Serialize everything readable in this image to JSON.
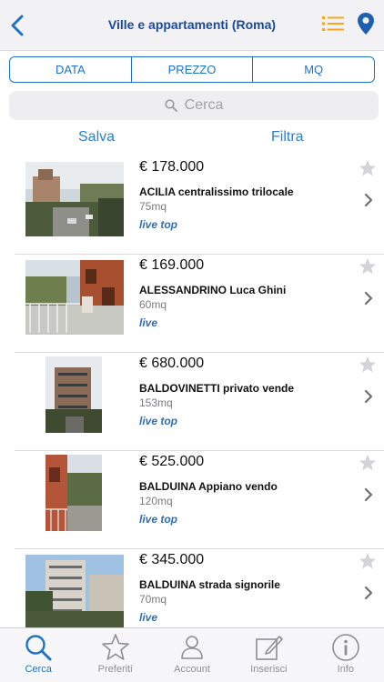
{
  "header": {
    "title": "Ville e appartamenti (Roma)",
    "back_icon": "chevron-left-icon",
    "list_icon": "list-icon",
    "location_icon": "map-pin-icon",
    "accent_color": "#1a4a9a",
    "icon_orange": "#f5a623"
  },
  "sort_tabs": [
    "DATA",
    "PREZZO",
    "MQ"
  ],
  "search": {
    "placeholder": "Cerca"
  },
  "actions": {
    "save_label": "Salva",
    "filter_label": "Filtra"
  },
  "listings": [
    {
      "price": "€ 178.000",
      "title": "ACILIA centralissimo trilocale",
      "size": "75mq",
      "badge": "live top"
    },
    {
      "price": "€ 169.000",
      "title": "ALESSANDRINO Luca Ghini",
      "size": "60mq",
      "badge": "live"
    },
    {
      "price": "€ 680.000",
      "title": "BALDOVINETTI privato vende",
      "size": "153mq",
      "badge": "live top"
    },
    {
      "price": "€ 525.000",
      "title": "BALDUINA Appiano vendo",
      "size": "120mq",
      "badge": "live top"
    },
    {
      "price": "€ 345.000",
      "title": "BALDUINA strada signorile",
      "size": "70mq",
      "badge": "live"
    }
  ],
  "tabbar": [
    {
      "label": "Cerca",
      "icon": "search-icon",
      "active": true
    },
    {
      "label": "Preferiti",
      "icon": "star-icon",
      "active": false
    },
    {
      "label": "Account",
      "icon": "user-icon",
      "active": false
    },
    {
      "label": "Inserisci",
      "icon": "edit-icon",
      "active": false
    },
    {
      "label": "Info",
      "icon": "info-icon",
      "active": false
    }
  ]
}
